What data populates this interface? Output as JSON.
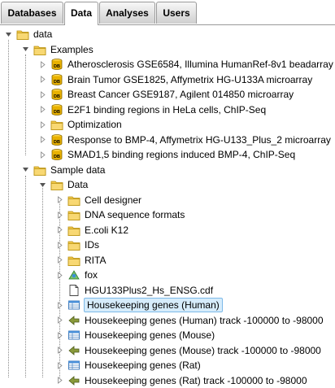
{
  "tabs": [
    {
      "label": "Databases",
      "active": false
    },
    {
      "label": "Data",
      "active": true
    },
    {
      "label": "Analyses",
      "active": false
    },
    {
      "label": "Users",
      "active": false
    }
  ],
  "tree": [
    {
      "label": "data",
      "level": 0,
      "expanded": true,
      "icon": "folder-icon"
    },
    {
      "label": "Examples",
      "level": 1,
      "expanded": true,
      "icon": "folder-icon"
    },
    {
      "label": "Atherosclerosis GSE6584, Illumina HumanRef-8v1 beadarray",
      "level": 2,
      "expanded": false,
      "icon": "database-icon"
    },
    {
      "label": "Brain Tumor GSE1825, Affymetrix HG-U133A microarray",
      "level": 2,
      "expanded": false,
      "icon": "database-icon"
    },
    {
      "label": "Breast Cancer GSE9187, Agilent 014850 microarray",
      "level": 2,
      "expanded": false,
      "icon": "database-icon"
    },
    {
      "label": "E2F1 binding regions in HeLa cells, ChIP-Seq",
      "level": 2,
      "expanded": false,
      "icon": "database-icon"
    },
    {
      "label": "Optimization",
      "level": 2,
      "expanded": false,
      "icon": "folder-icon"
    },
    {
      "label": "Response to BMP-4, Affymetrix HG-U133_Plus_2 microarray",
      "level": 2,
      "expanded": false,
      "icon": "database-icon"
    },
    {
      "label": "SMAD1,5 binding regions induced BMP-4, ChIP-Seq",
      "level": 2,
      "expanded": false,
      "icon": "database-icon"
    },
    {
      "label": "Sample data",
      "level": 1,
      "expanded": true,
      "icon": "folder-icon"
    },
    {
      "label": "Data",
      "level": 2,
      "expanded": true,
      "icon": "folder-icon"
    },
    {
      "label": "Cell designer",
      "level": 3,
      "expanded": false,
      "icon": "folder-icon"
    },
    {
      "label": "DNA sequence formats",
      "level": 3,
      "expanded": false,
      "icon": "folder-icon"
    },
    {
      "label": "E.coli K12",
      "level": 3,
      "expanded": false,
      "icon": "folder-icon"
    },
    {
      "label": "IDs",
      "level": 3,
      "expanded": false,
      "icon": "folder-icon"
    },
    {
      "label": "RITA",
      "level": 3,
      "expanded": false,
      "icon": "folder-icon"
    },
    {
      "label": "fox",
      "level": 3,
      "expanded": false,
      "icon": "genome-icon"
    },
    {
      "label": "HGU133Plus2_Hs_ENSG.cdf",
      "level": 3,
      "leaf": true,
      "icon": "file-icon"
    },
    {
      "label": "Housekeeping genes (Human)",
      "level": 3,
      "expanded": false,
      "icon": "table-icon",
      "selected": true
    },
    {
      "label": "Housekeeping genes (Human) track -100000 to -98000",
      "level": 3,
      "expanded": false,
      "icon": "track-icon"
    },
    {
      "label": "Housekeeping genes (Mouse)",
      "level": 3,
      "expanded": false,
      "icon": "table-icon"
    },
    {
      "label": "Housekeeping genes (Mouse) track -100000 to -98000",
      "level": 3,
      "expanded": false,
      "icon": "track-icon"
    },
    {
      "label": "Housekeeping genes (Rat)",
      "level": 3,
      "expanded": false,
      "icon": "table-icon"
    },
    {
      "label": "Housekeeping genes (Rat) track -100000 to -98000",
      "level": 3,
      "expanded": false,
      "icon": "track-icon"
    }
  ],
  "colors": {
    "folder": "#f2c84b",
    "selection": "#d6ecfb",
    "database": "#e8b100"
  }
}
